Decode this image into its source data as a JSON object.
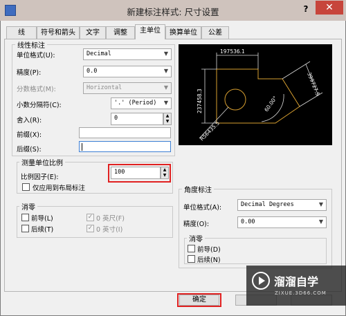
{
  "window": {
    "title": "新建标注样式: 尺寸设置",
    "help": "?",
    "close": "✕"
  },
  "tabs": [
    "线",
    "符号和箭头",
    "文字",
    "调整",
    "主单位",
    "换算单位",
    "公差"
  ],
  "active_tab": "主单位",
  "linear": {
    "legend": "线性标注",
    "unit_format": {
      "label": "单位格式(U):",
      "value": "Decimal"
    },
    "precision": {
      "label": "精度(P):",
      "value": "0.0"
    },
    "fraction_format": {
      "label": "分数格式(M):",
      "value": "Horizontal"
    },
    "decimal_sep": {
      "label": "小数分隔符(C):",
      "value": "'.' (Period)"
    },
    "round": {
      "label": "舍入(R):",
      "value": "0"
    },
    "prefix": {
      "label": "前缀(X):",
      "value": ""
    },
    "suffix": {
      "label": "后缀(S):",
      "value": ""
    }
  },
  "scale": {
    "legend": "测量单位比例",
    "factor": {
      "label": "比例因子(E):",
      "value": "100"
    },
    "layout_only": {
      "label": "仅应用到布局标注",
      "checked": false
    }
  },
  "zero_suppress_linear": {
    "legend": "消零",
    "leading": {
      "label": "前导(L)",
      "checked": false
    },
    "trailing": {
      "label": "后续(T)",
      "checked": false
    },
    "feet": {
      "label": "0 英尺(F)",
      "checked": true
    },
    "inches": {
      "label": "0 英寸(I)",
      "checked": true
    }
  },
  "preview": {
    "dim_top": "197536.1",
    "dim_left": "237458.3",
    "dim_right": "399727.5",
    "dim_radius": "R56435.5",
    "angle": "60.00°"
  },
  "angular": {
    "legend": "角度标注",
    "unit_format": {
      "label": "单位格式(A):",
      "value": "Decimal Degrees"
    },
    "precision": {
      "label": "精度(O):",
      "value": "0.00"
    },
    "zero_legend": "消零",
    "leading": {
      "label": "前导(D)",
      "checked": false
    },
    "trailing": {
      "label": "后续(N)",
      "checked": false
    }
  },
  "buttons": {
    "ok": "确定"
  },
  "watermark": {
    "brand": "溜溜自学",
    "url": "ZIXUE.3D66.COM"
  },
  "colors": {
    "accent_red": "#e02020",
    "close_red": "#c7453b",
    "preview_bg": "#000000",
    "preview_shape": "#d9a030"
  }
}
